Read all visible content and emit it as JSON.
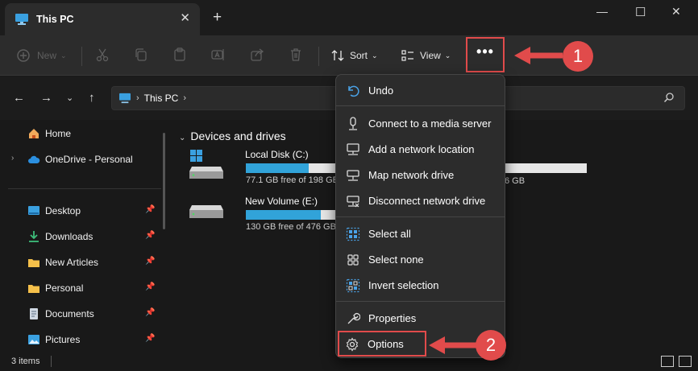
{
  "window": {
    "tab_title": "This PC",
    "tab_close": "✕",
    "new_tab": "+",
    "minimize": "—",
    "maximize": "☐",
    "close": "✕"
  },
  "toolbar": {
    "new_label": "New",
    "sort_label": "Sort",
    "view_label": "View",
    "see_more_label": "•••"
  },
  "address": {
    "crumb": "This PC",
    "chevron": "›",
    "search_icon": "search-icon"
  },
  "sidebar": {
    "items": [
      {
        "label": "Home",
        "icon": "home-icon",
        "pinned": false,
        "expandable": false
      },
      {
        "label": "OneDrive - Personal",
        "icon": "cloud-icon",
        "pinned": false,
        "expandable": true
      },
      {
        "label": "Desktop",
        "icon": "desktop-icon",
        "pinned": true
      },
      {
        "label": "Downloads",
        "icon": "download-icon",
        "pinned": true
      },
      {
        "label": "New Articles",
        "icon": "folder-icon",
        "pinned": true
      },
      {
        "label": "Personal",
        "icon": "folder-icon",
        "pinned": true
      },
      {
        "label": "Documents",
        "icon": "document-icon",
        "pinned": true
      },
      {
        "label": "Pictures",
        "icon": "pictures-icon",
        "pinned": true
      }
    ]
  },
  "content": {
    "group_title": "Devices and drives",
    "drives": [
      {
        "name": "Local Disk (C:)",
        "free": "77.1 GB free of 198 GB",
        "used_fraction": 0.61
      },
      {
        "name": "New Volume (E:)",
        "free": "130 GB free of 476 GB",
        "used_fraction": 0.73
      }
    ],
    "hidden_drive_free_tail": "6 GB"
  },
  "status": {
    "items_count": "3 items"
  },
  "menu": {
    "items": [
      {
        "label": "Undo",
        "icon": "undo-icon"
      },
      {
        "label": "Connect to a media server",
        "icon": "media-server-icon"
      },
      {
        "label": "Add a network location",
        "icon": "network-location-icon"
      },
      {
        "label": "Map network drive",
        "icon": "map-drive-icon"
      },
      {
        "label": "Disconnect network drive",
        "icon": "disconnect-drive-icon"
      },
      {
        "label": "Select all",
        "icon": "select-all-icon"
      },
      {
        "label": "Select none",
        "icon": "select-none-icon"
      },
      {
        "label": "Invert selection",
        "icon": "invert-selection-icon"
      },
      {
        "label": "Properties",
        "icon": "properties-icon"
      },
      {
        "label": "Options",
        "icon": "gear-icon"
      }
    ]
  },
  "annotations": {
    "step1": "1",
    "step2": "2",
    "color": "#e14b4b"
  },
  "colors": {
    "accent_bar": "#31a3d9",
    "background": "#191919",
    "menu_bg": "#2c2c2c"
  }
}
